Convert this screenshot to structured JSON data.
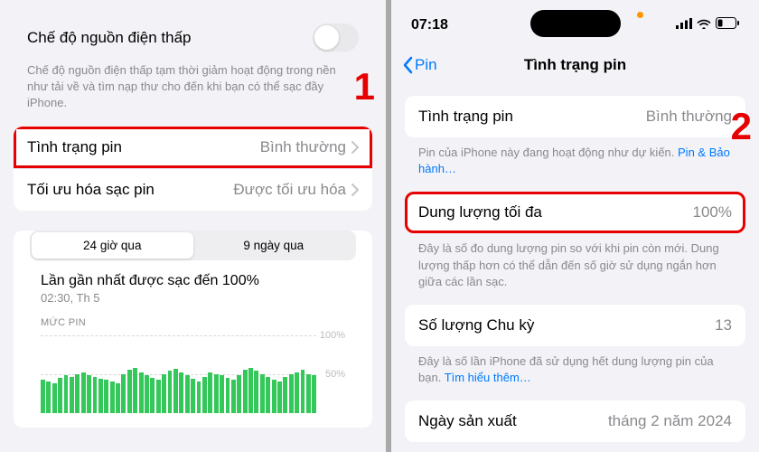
{
  "left": {
    "low_power_label": "Chế độ nguồn điện thấp",
    "low_power_desc": "Chế độ nguồn điện thấp tạm thời giảm hoạt động trong nền như tải về và tìm nạp thư cho đến khi bạn có thể sạc đầy iPhone.",
    "battery_condition_label": "Tình trạng pin",
    "battery_condition_value": "Bình thường",
    "optimize_label": "Tối ưu hóa sạc pin",
    "optimize_value": "Được tối ưu hóa",
    "seg_24h": "24 giờ qua",
    "seg_9d": "9 ngày qua",
    "chart_title": "Lần gần nhất được sạc đến 100%",
    "chart_sub": "02:30, Th 5",
    "chart_caption": "MỨC PIN",
    "annotation_1": "1"
  },
  "right": {
    "time": "07:18",
    "back_label": "Pin",
    "nav_title": "Tình trạng pin",
    "condition_label": "Tình trạng pin",
    "condition_value": "Bình thường",
    "condition_footer_a": "Pin của iPhone này đang hoạt động như dự kiến. ",
    "condition_footer_link": "Pin & Bảo hành…",
    "maxcap_label": "Dung lượng tối đa",
    "maxcap_value": "100%",
    "maxcap_footer": "Đây là số đo dung lượng pin so với khi pin còn mới. Dung lượng thấp hơn có thể dẫn đến số giờ sử dụng ngắn hơn giữa các lần sạc.",
    "cycle_label": "Số lượng Chu kỳ",
    "cycle_value": "13",
    "cycle_footer_a": "Đây là số lần iPhone đã sử dụng hết dung lượng pin của bạn. ",
    "cycle_footer_link": "Tìm hiểu thêm…",
    "mfg_label": "Ngày sản xuất",
    "mfg_value": "tháng 2 năm 2024",
    "annotation_2": "2"
  },
  "chart_data": {
    "type": "bar",
    "title": "MỨC PIN",
    "ylabel": "%",
    "ylim": [
      0,
      100
    ],
    "grid_values": [
      50,
      100
    ],
    "values": [
      42,
      40,
      38,
      45,
      48,
      46,
      50,
      52,
      48,
      46,
      44,
      42,
      40,
      38,
      50,
      55,
      58,
      52,
      48,
      45,
      42,
      50,
      54,
      56,
      52,
      48,
      44,
      40,
      46,
      52,
      50,
      48,
      45,
      42,
      48,
      55,
      58,
      54,
      50,
      46,
      42,
      40,
      46,
      50,
      52,
      55,
      50,
      48
    ]
  }
}
